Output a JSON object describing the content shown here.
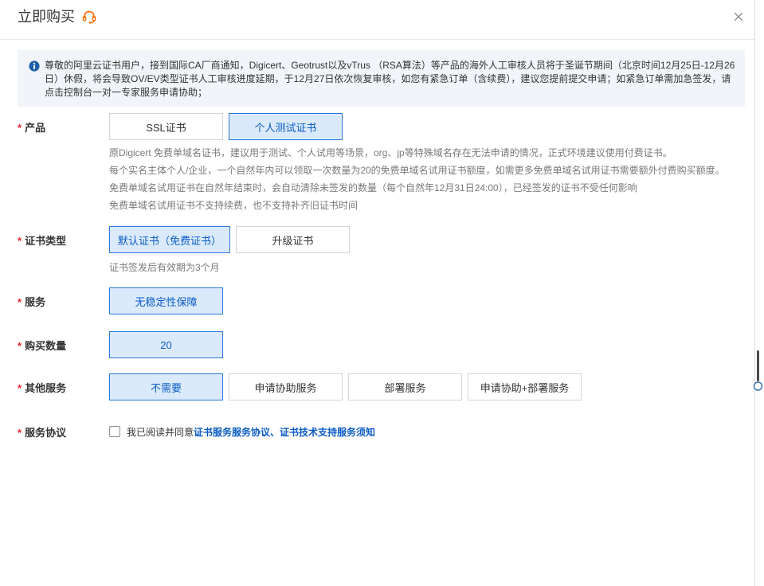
{
  "dialog": {
    "title": "立即购买",
    "title_icon": "headset-icon",
    "close_icon": "close-icon"
  },
  "notice": {
    "icon": "info-icon",
    "text": "尊敬的阿里云证书用户，接到国际CA厂商通知，Digicert、Geotrust以及vTrus （RSA算法）等产品的海外人工审核人员将于圣诞节期间（北京时间12月25日-12月26日）休假，将会导致OV/EV类型证书人工审核进度延期，于12月27日依次恢复审核，如您有紧急订单（含续费），建议您提前提交申请；如紧急订单需加急签发，请点击控制台一对一专家服务申请协助；"
  },
  "form": {
    "required_mark": "*",
    "product": {
      "label": "产品",
      "options": [
        {
          "label": "SSL证书",
          "selected": false
        },
        {
          "label": "个人测试证书",
          "selected": true
        }
      ],
      "description": [
        "原Digicert 免费单域名证书，建议用于测试、个人试用等场景，org、jp等特殊域名存在无法申请的情况，正式环境建议使用付费证书。",
        "每个实名主体个人/企业，一个自然年内可以领取一次数量为20的免费单域名试用证书额度，如需更多免费单域名试用证书需要额外付费购买额度。",
        "免费单域名试用证书在自然年结束时，会自动清除未签发的数量（每个自然年12月31日24:00），已经签发的证书不受任何影响",
        "免费单域名试用证书不支持续费，也不支持补齐旧证书时间"
      ]
    },
    "cert_type": {
      "label": "证书类型",
      "options": [
        {
          "label": "默认证书（免费证书）",
          "selected": true
        },
        {
          "label": "升级证书",
          "selected": false
        }
      ],
      "description": [
        "证书签发后有效期为3个月"
      ]
    },
    "service": {
      "label": "服务",
      "options": [
        {
          "label": "无稳定性保障",
          "selected": true
        }
      ]
    },
    "quantity": {
      "label": "购买数量",
      "value": "20"
    },
    "other_services": {
      "label": "其他服务",
      "options": [
        {
          "label": "不需要",
          "selected": true
        },
        {
          "label": "申请协助服务",
          "selected": false
        },
        {
          "label": "部署服务",
          "selected": false
        },
        {
          "label": "申请协助+部署服务",
          "selected": false
        }
      ]
    },
    "agreement": {
      "label": "服务协议",
      "checked": false,
      "prefix": "我已阅读并同意",
      "links": [
        "证书服务服务协议",
        "证书技术支持服务须知"
      ],
      "separator": "、"
    }
  },
  "colors": {
    "accent": "#0a5cc4",
    "required": "#e5242b",
    "headset_icon": "#ff6a00",
    "info_icon": "#1f5fa8",
    "notice_background": "#f1f4f8"
  }
}
